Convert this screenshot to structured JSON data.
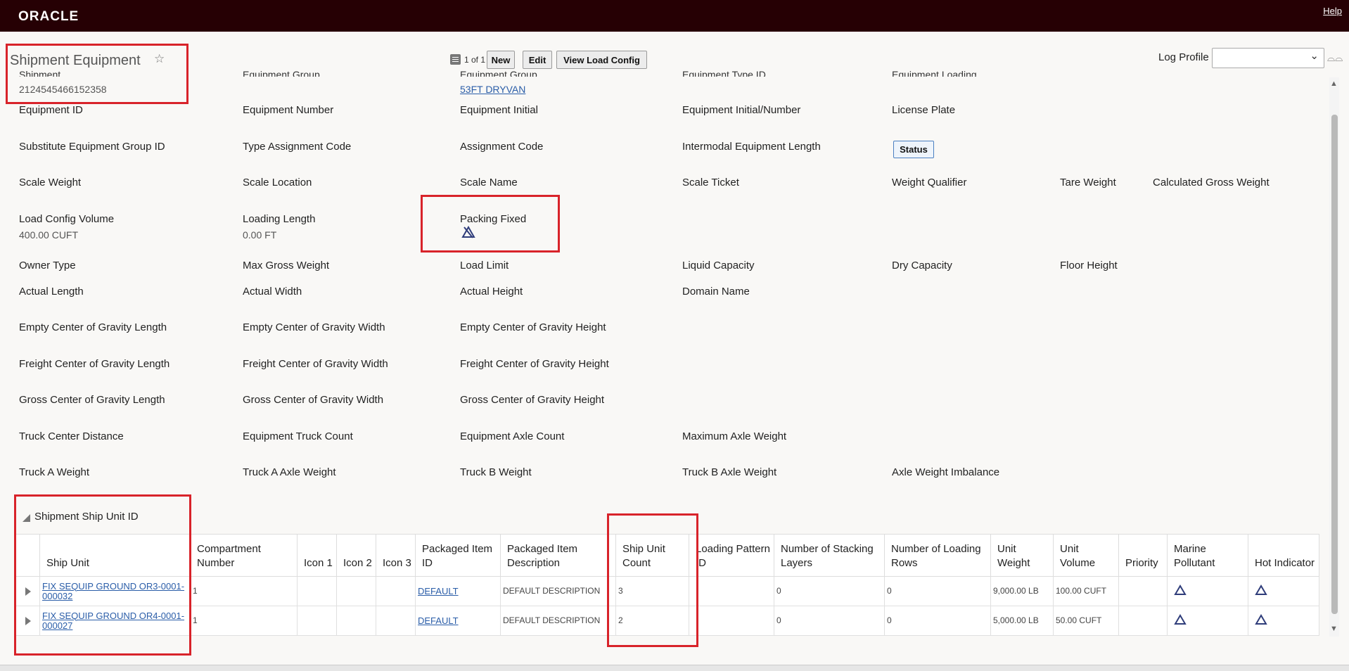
{
  "header": {
    "logo": "ORACLE",
    "help": "Help"
  },
  "page": {
    "title": "Shipment Equipment",
    "equipment_id_value": "2124545466152358",
    "equipment_type_link": "53FT DRYVAN"
  },
  "toolbar": {
    "pager": "1 of 1",
    "new_label": "New",
    "edit_label": "Edit",
    "view_load_config_label": "View Load Config",
    "log_profile_label": "Log Profile",
    "log_profile_value": ""
  },
  "fields": {
    "equipment_id": "Equipment ID",
    "equipment_number": "Equipment Number",
    "equipment_initial": "Equipment Initial",
    "equipment_initial_number": "Equipment Initial/Number",
    "license_plate": "License Plate",
    "substitute_group": "Substitute Equipment Group ID",
    "type_assignment_code": "Type Assignment Code",
    "assignment_code": "Assignment Code",
    "intermodal_length": "Intermodal Equipment Length",
    "status_button": "Status",
    "scale_weight": "Scale Weight",
    "scale_location": "Scale Location",
    "scale_name": "Scale Name",
    "scale_ticket": "Scale Ticket",
    "weight_qualifier": "Weight Qualifier",
    "tare_weight": "Tare Weight",
    "calculated_gross_weight": "Calculated Gross Weight",
    "load_config_volume": "Load Config Volume",
    "load_config_volume_value": "400.00 CUFT",
    "loading_length": "Loading Length",
    "loading_length_value": "0.00 FT",
    "packing_fixed": "Packing Fixed",
    "owner_type": "Owner Type",
    "max_gross_weight": "Max Gross Weight",
    "load_limit": "Load Limit",
    "liquid_capacity": "Liquid Capacity",
    "dry_capacity": "Dry Capacity",
    "floor_height": "Floor Height",
    "actual_length": "Actual Length",
    "actual_width": "Actual Width",
    "actual_height": "Actual Height",
    "domain_name": "Domain Name",
    "empty_cog_length": "Empty Center of Gravity Length",
    "empty_cog_width": "Empty Center of Gravity Width",
    "empty_cog_height": "Empty Center of Gravity Height",
    "freight_cog_length": "Freight Center of Gravity Length",
    "freight_cog_width": "Freight Center of Gravity Width",
    "freight_cog_height": "Freight Center of Gravity Height",
    "gross_cog_length": "Gross Center of Gravity Length",
    "gross_cog_width": "Gross Center of Gravity Width",
    "gross_cog_height": "Gross Center of Gravity Height",
    "truck_center_distance": "Truck Center Distance",
    "equipment_truck_count": "Equipment Truck Count",
    "equipment_axle_count": "Equipment Axle Count",
    "maximum_axle_weight": "Maximum Axle Weight",
    "truck_a_weight": "Truck A Weight",
    "truck_a_axle_weight": "Truck A Axle Weight",
    "truck_b_weight": "Truck B Weight",
    "truck_b_axle_weight": "Truck B Axle Weight",
    "axle_weight_imbalance": "Axle Weight Imbalance"
  },
  "ship_unit_section": {
    "title": "Shipment Ship Unit ID",
    "columns": {
      "ship_unit": "Ship Unit",
      "compartment_number": "Compartment Number",
      "icon1": "Icon 1",
      "icon2": "Icon 2",
      "icon3": "Icon 3",
      "packaged_item_id": "Packaged Item ID",
      "packaged_item_description": "Packaged Item Description",
      "ship_unit_count": "Ship Unit Count",
      "loading_pattern_id": "Loading Pattern ID",
      "number_of_stacking_layers": "Number of Stacking Layers",
      "number_of_loading_rows": "Number of Loading Rows",
      "unit_weight": "Unit Weight",
      "unit_volume": "Unit Volume",
      "priority": "Priority",
      "marine_pollutant": "Marine Pollutant",
      "hot_indicator": "Hot Indicator"
    },
    "rows": [
      {
        "ship_unit": "FIX SEQUIP GROUND OR3-0001-000032",
        "compartment_number": "1",
        "packaged_item_id": "DEFAULT",
        "packaged_item_description": "DEFAULT DESCRIPTION",
        "ship_unit_count": "3",
        "loading_pattern_id": "",
        "number_of_stacking_layers": "0",
        "number_of_loading_rows": "0",
        "unit_weight": "9,000.00 LB",
        "unit_volume": "100.00 CUFT",
        "priority": "",
        "marine_pollutant_icon": "triangle-outline-icon",
        "hot_indicator_icon": "triangle-outline-icon"
      },
      {
        "ship_unit": "FIX SEQUIP GROUND OR4-0001-000027",
        "compartment_number": "1",
        "packaged_item_id": "DEFAULT",
        "packaged_item_description": "DEFAULT DESCRIPTION",
        "ship_unit_count": "2",
        "loading_pattern_id": "",
        "number_of_stacking_layers": "0",
        "number_of_loading_rows": "0",
        "unit_weight": "5,000.00 LB",
        "unit_volume": "50.00 CUFT",
        "priority": "",
        "marine_pollutant_icon": "triangle-outline-icon",
        "hot_indicator_icon": "triangle-outline-icon"
      }
    ]
  },
  "colors": {
    "header_bg": "#260004",
    "highlight_box": "#d8232a",
    "link": "#2a5da8",
    "icon_blue": "#2f3d7a"
  }
}
